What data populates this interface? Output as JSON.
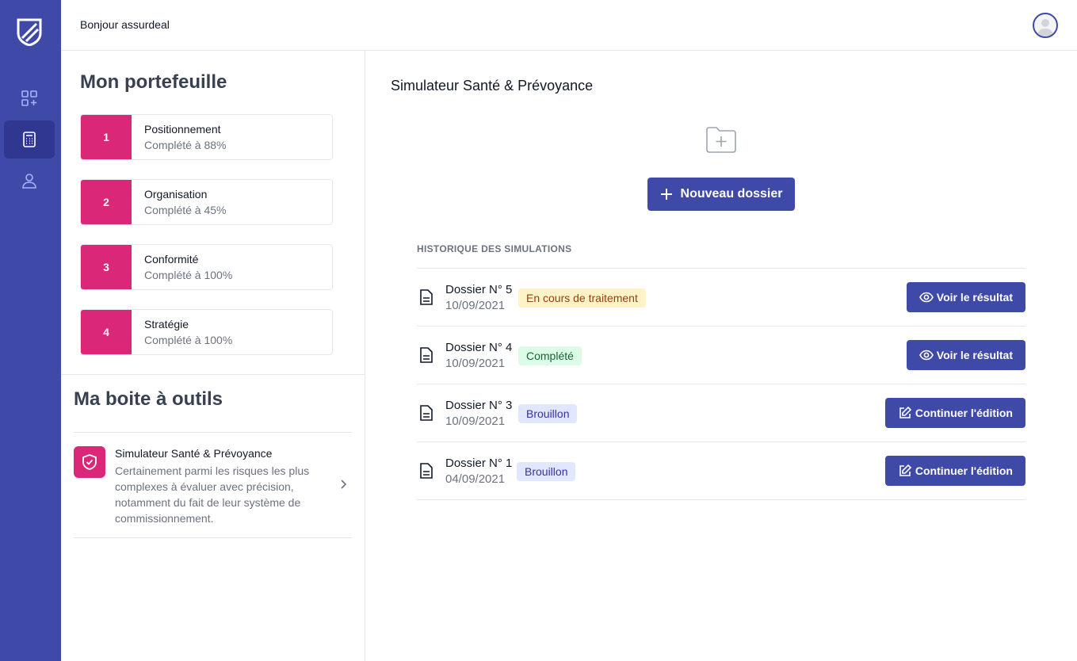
{
  "header": {
    "greeting": "Bonjour assurdeal"
  },
  "sidebar": {
    "items": [
      "dashboard-icon",
      "calculator-icon",
      "user-icon"
    ],
    "active_index": 1
  },
  "portfolio": {
    "title": "Mon portefeuille",
    "steps": [
      {
        "number": "1",
        "name": "Positionnement",
        "status": "Complété à 88%"
      },
      {
        "number": "2",
        "name": "Organisation",
        "status": "Complété à 45%"
      },
      {
        "number": "3",
        "name": "Conformité",
        "status": "Complété à 100%"
      },
      {
        "number": "4",
        "name": "Stratégie",
        "status": "Complété à 100%"
      }
    ]
  },
  "toolbox": {
    "title": "Ma boite à outils",
    "tool": {
      "name": "Simulateur Santé & Prévoyance",
      "description": "Certainement parmi les risques les plus complexes à évaluer avec précision, notamment du fait de leur système de commissionnement."
    }
  },
  "main": {
    "title": "Simulateur Santé & Prévoyance",
    "new_button": "Nouveau dossier",
    "history_label": "HISTORIQUE DES SIMULATIONS",
    "dossiers": [
      {
        "name": "Dossier N° 5",
        "date": "10/09/2021",
        "status": "En cours de traitement",
        "action": "Voir le résultat"
      },
      {
        "name": "Dossier N° 4",
        "date": "10/09/2021",
        "status": "Complété",
        "action": "Voir le résultat"
      },
      {
        "name": "Dossier N° 3",
        "date": "10/09/2021",
        "status": "Brouillon",
        "action": "Continuer l'édition"
      },
      {
        "name": "Dossier N° 1",
        "date": "04/09/2021",
        "status": "Brouillon",
        "action": "Continuer l'édition"
      }
    ]
  },
  "colors": {
    "primary": "#3f4aa8",
    "accent": "#db2777",
    "badge_orange": "#fef3c7",
    "badge_green": "#dcfce7",
    "badge_blue": "#e0e7ff"
  }
}
